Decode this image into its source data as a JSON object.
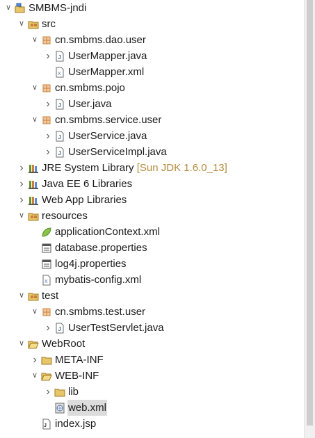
{
  "tree": [
    {
      "depth": 0,
      "toggle": "open",
      "icon": "project-icon",
      "label": "SMBMS-jndi"
    },
    {
      "depth": 1,
      "toggle": "open",
      "icon": "source-folder-icon",
      "label": "src"
    },
    {
      "depth": 2,
      "toggle": "open",
      "icon": "package-icon",
      "label": "cn.smbms.dao.user"
    },
    {
      "depth": 3,
      "toggle": "closed",
      "icon": "java-file-icon",
      "label": "UserMapper.java"
    },
    {
      "depth": 3,
      "toggle": "none",
      "icon": "xml-file-icon",
      "label": "UserMapper.xml"
    },
    {
      "depth": 2,
      "toggle": "open",
      "icon": "package-icon",
      "label": "cn.smbms.pojo"
    },
    {
      "depth": 3,
      "toggle": "closed",
      "icon": "java-file-icon",
      "label": "User.java"
    },
    {
      "depth": 2,
      "toggle": "open",
      "icon": "package-icon",
      "label": "cn.smbms.service.user"
    },
    {
      "depth": 3,
      "toggle": "closed",
      "icon": "java-file-icon",
      "label": "UserService.java"
    },
    {
      "depth": 3,
      "toggle": "closed",
      "icon": "java-file-icon",
      "label": "UserServiceImpl.java"
    },
    {
      "depth": 1,
      "toggle": "closed",
      "icon": "library-icon",
      "label": "JRE System Library",
      "decoration": "[Sun JDK 1.6.0_13]"
    },
    {
      "depth": 1,
      "toggle": "closed",
      "icon": "library-icon",
      "label": "Java EE 6 Libraries"
    },
    {
      "depth": 1,
      "toggle": "closed",
      "icon": "library-icon",
      "label": "Web App Libraries"
    },
    {
      "depth": 1,
      "toggle": "open",
      "icon": "source-folder-icon",
      "label": "resources"
    },
    {
      "depth": 2,
      "toggle": "none",
      "icon": "spring-leaf-icon",
      "label": "applicationContext.xml"
    },
    {
      "depth": 2,
      "toggle": "none",
      "icon": "properties-file-icon",
      "label": "database.properties"
    },
    {
      "depth": 2,
      "toggle": "none",
      "icon": "properties-file-icon",
      "label": "log4j.properties"
    },
    {
      "depth": 2,
      "toggle": "none",
      "icon": "xml-file-icon",
      "label": "mybatis-config.xml"
    },
    {
      "depth": 1,
      "toggle": "open",
      "icon": "source-folder-icon",
      "label": "test"
    },
    {
      "depth": 2,
      "toggle": "open",
      "icon": "package-icon",
      "label": "cn.smbms.test.user"
    },
    {
      "depth": 3,
      "toggle": "closed",
      "icon": "java-file-icon",
      "label": "UserTestServlet.java"
    },
    {
      "depth": 1,
      "toggle": "open",
      "icon": "folder-open-icon",
      "label": "WebRoot"
    },
    {
      "depth": 2,
      "toggle": "closed",
      "icon": "folder-closed-icon",
      "label": "META-INF"
    },
    {
      "depth": 2,
      "toggle": "open",
      "icon": "folder-open-icon",
      "label": "WEB-INF"
    },
    {
      "depth": 3,
      "toggle": "closed",
      "icon": "folder-closed-icon",
      "label": "lib"
    },
    {
      "depth": 3,
      "toggle": "none",
      "icon": "web-xml-icon",
      "label": "web.xml",
      "selected": true
    },
    {
      "depth": 2,
      "toggle": "none",
      "icon": "jsp-file-icon",
      "label": "index.jsp"
    }
  ],
  "colors": {
    "selection": "#dcdcdc",
    "decoration": "#b58a3c",
    "package": "#c8803a",
    "folder": "#e8c66a",
    "java": "#4a6fa5"
  }
}
